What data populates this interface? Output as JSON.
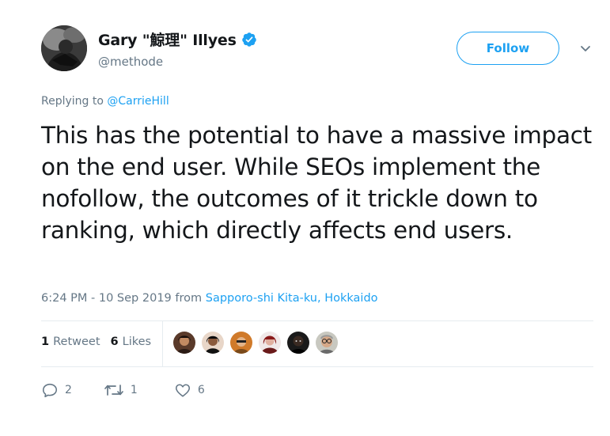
{
  "author": {
    "display_name": "Gary \"鯨理\" Illyes",
    "handle": "@methode",
    "verified_icon": "verified-badge-icon"
  },
  "header": {
    "follow_label": "Follow",
    "caret_icon": "chevron-down-icon"
  },
  "reply": {
    "prefix": "Replying to ",
    "mention": "@CarrieHill"
  },
  "tweet": {
    "text": "This has the potential to have a massive impact on the end user. While SEOs implement the nofollow, the outcomes of it trickle down to ranking, which directly affects end users."
  },
  "meta": {
    "timestamp": "6:24 PM - 10 Sep 2019",
    "from_label": " from ",
    "location": "Sapporo-shi Kita-ku, Hokkaido"
  },
  "stats": {
    "retweets_count": "1",
    "retweets_label": "Retweet",
    "likes_count": "6",
    "likes_label": "Likes"
  },
  "actions": {
    "reply_count": "2",
    "retweet_count": "1",
    "like_count": "6"
  },
  "colors": {
    "accent": "#1da1f2",
    "secondary_text": "#657786",
    "primary_text": "#14171a",
    "divider": "#e6ecf0"
  }
}
